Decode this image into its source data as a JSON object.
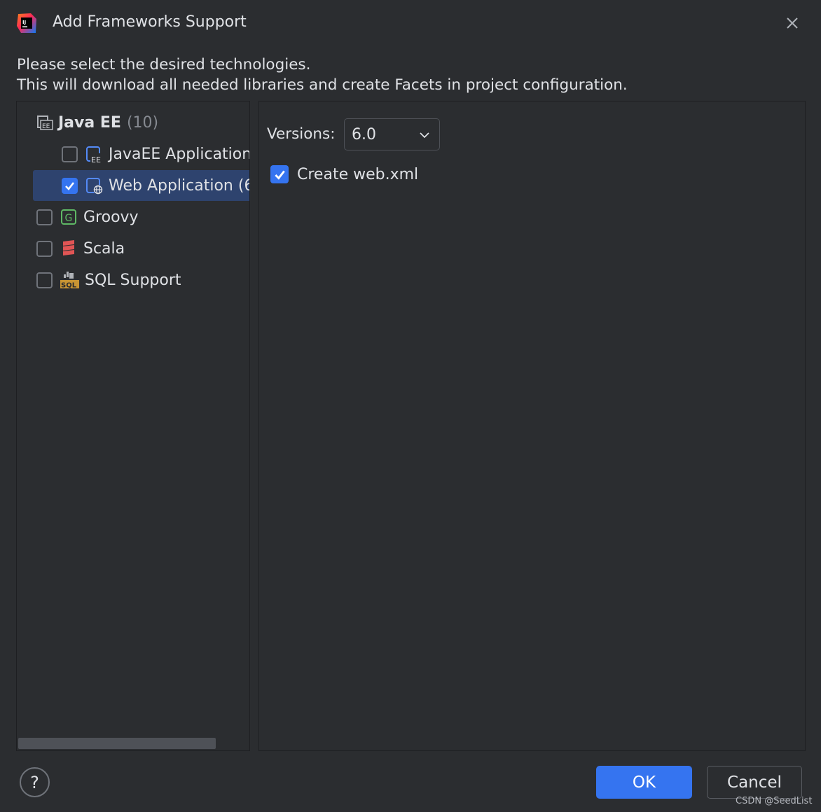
{
  "window": {
    "title": "Add Frameworks Support",
    "app_icon": "intellij-idea-icon",
    "close_icon": "close-icon"
  },
  "description": {
    "line1": "Please select the desired technologies.",
    "line2": "This will download all needed libraries and create Facets in project configuration."
  },
  "tree": {
    "group": {
      "label": "Java EE",
      "count": "(10)",
      "icon": "javaee-folder-icon"
    },
    "items": [
      {
        "label": "JavaEE Application",
        "checked": false,
        "icon": "javaee-application-icon"
      },
      {
        "label": "Web Application (6",
        "checked": true,
        "selected": true,
        "icon": "web-application-icon"
      },
      {
        "label": "Groovy",
        "checked": false,
        "icon": "groovy-icon"
      },
      {
        "label": "Scala",
        "checked": false,
        "icon": "scala-icon"
      },
      {
        "label": "SQL Support",
        "checked": false,
        "icon": "sql-icon"
      }
    ]
  },
  "settings": {
    "versions_label": "Versions:",
    "versions_value": "6.0",
    "create_webxml_label": "Create web.xml",
    "create_webxml_checked": true
  },
  "footer": {
    "help_label": "?",
    "ok_label": "OK",
    "cancel_label": "Cancel"
  },
  "watermark": "CSDN @SeedList",
  "colors": {
    "background": "#2b2d30",
    "accent": "#3574f0",
    "selection": "#2e436e",
    "text": "#dfe1e5",
    "muted": "#868a91"
  }
}
